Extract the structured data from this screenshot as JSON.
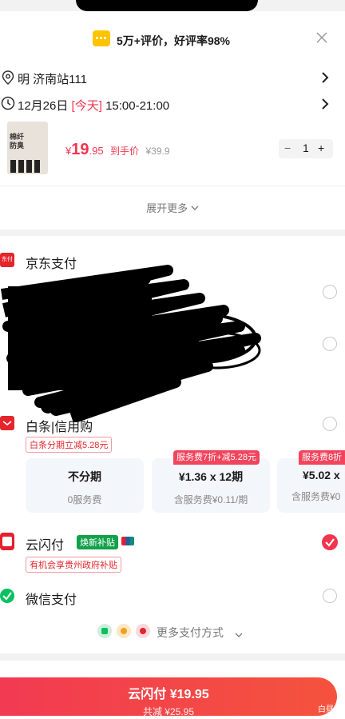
{
  "banner": {
    "text": "5万+评价，好评率98%"
  },
  "address": {
    "text": "明 济南站111"
  },
  "delivery": {
    "date": "12月26日",
    "today": "[今天]",
    "time": "15:00-21:00"
  },
  "product": {
    "thumb_text": "棉纤防臭",
    "price_symbol": "¥",
    "price_int": "19",
    "price_dec": ".95",
    "price_label": "到手价",
    "original_price": "¥39.9",
    "qty": "1",
    "minus": "−",
    "plus": "+"
  },
  "expand": {
    "label": "展开更多"
  },
  "payments": {
    "jd": {
      "icon_text": "东付",
      "title": "京东支付"
    },
    "baitiao": {
      "title": "白条|信用购",
      "tag": "白条分期立减5.28元",
      "options": [
        {
          "label": "不分期",
          "sub": "0服务费",
          "tag": ""
        },
        {
          "label": "¥1.36 x 12期",
          "sub": "含服务费¥0.11/期",
          "tag": "服务费7折+减5.28元"
        },
        {
          "label": "¥5.02 x",
          "sub": "含服务费¥0",
          "tag": "服务费8折"
        }
      ]
    },
    "unionpay": {
      "title": "云闪付",
      "badge": "焕新补贴",
      "sub_tag": "有机会享贵州政府补贴"
    },
    "wechat": {
      "title": "微信支付"
    },
    "more": {
      "label": "更多支付方式"
    }
  },
  "footer": {
    "pay_label": "云闪付 ¥19.95",
    "saving": "共减 ¥25.95",
    "corner": "白昼"
  },
  "colors": {
    "accent": "#f2344f",
    "green": "#07c160",
    "unionpay_red": "#e5202e"
  }
}
